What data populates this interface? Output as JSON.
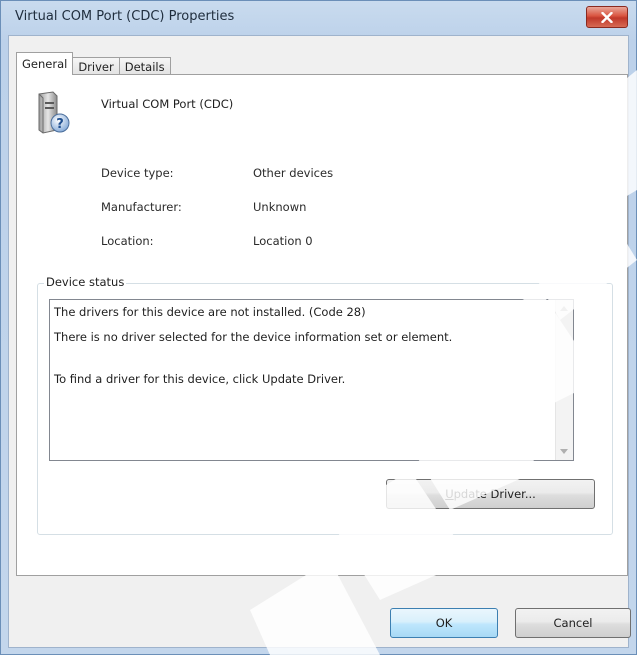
{
  "window": {
    "title": "Virtual COM Port (CDC) Properties"
  },
  "tabs": [
    {
      "label": "General",
      "active": true
    },
    {
      "label": "Driver",
      "active": false
    },
    {
      "label": "Details",
      "active": false
    }
  ],
  "device": {
    "name": "Virtual COM Port (CDC)",
    "icon": "unknown-device-icon"
  },
  "properties": [
    {
      "label": "Device type:",
      "value": "Other devices"
    },
    {
      "label": "Manufacturer:",
      "value": "Unknown"
    },
    {
      "label": "Location:",
      "value": "Location 0"
    }
  ],
  "status": {
    "title": "Device status",
    "lines": [
      "The drivers for this device are not installed. (Code 28)",
      "There is no driver selected for the device information set or element.",
      "To find a driver for this device, click Update Driver."
    ]
  },
  "buttons": {
    "update_driver_mnemonic": "U",
    "update_driver_rest": "pdate Driver...",
    "ok": "OK",
    "cancel": "Cancel"
  },
  "colors": {
    "title_bar": "#c9dbee",
    "close_button": "#d9533f",
    "ok_button_border": "#3c7fb1"
  }
}
